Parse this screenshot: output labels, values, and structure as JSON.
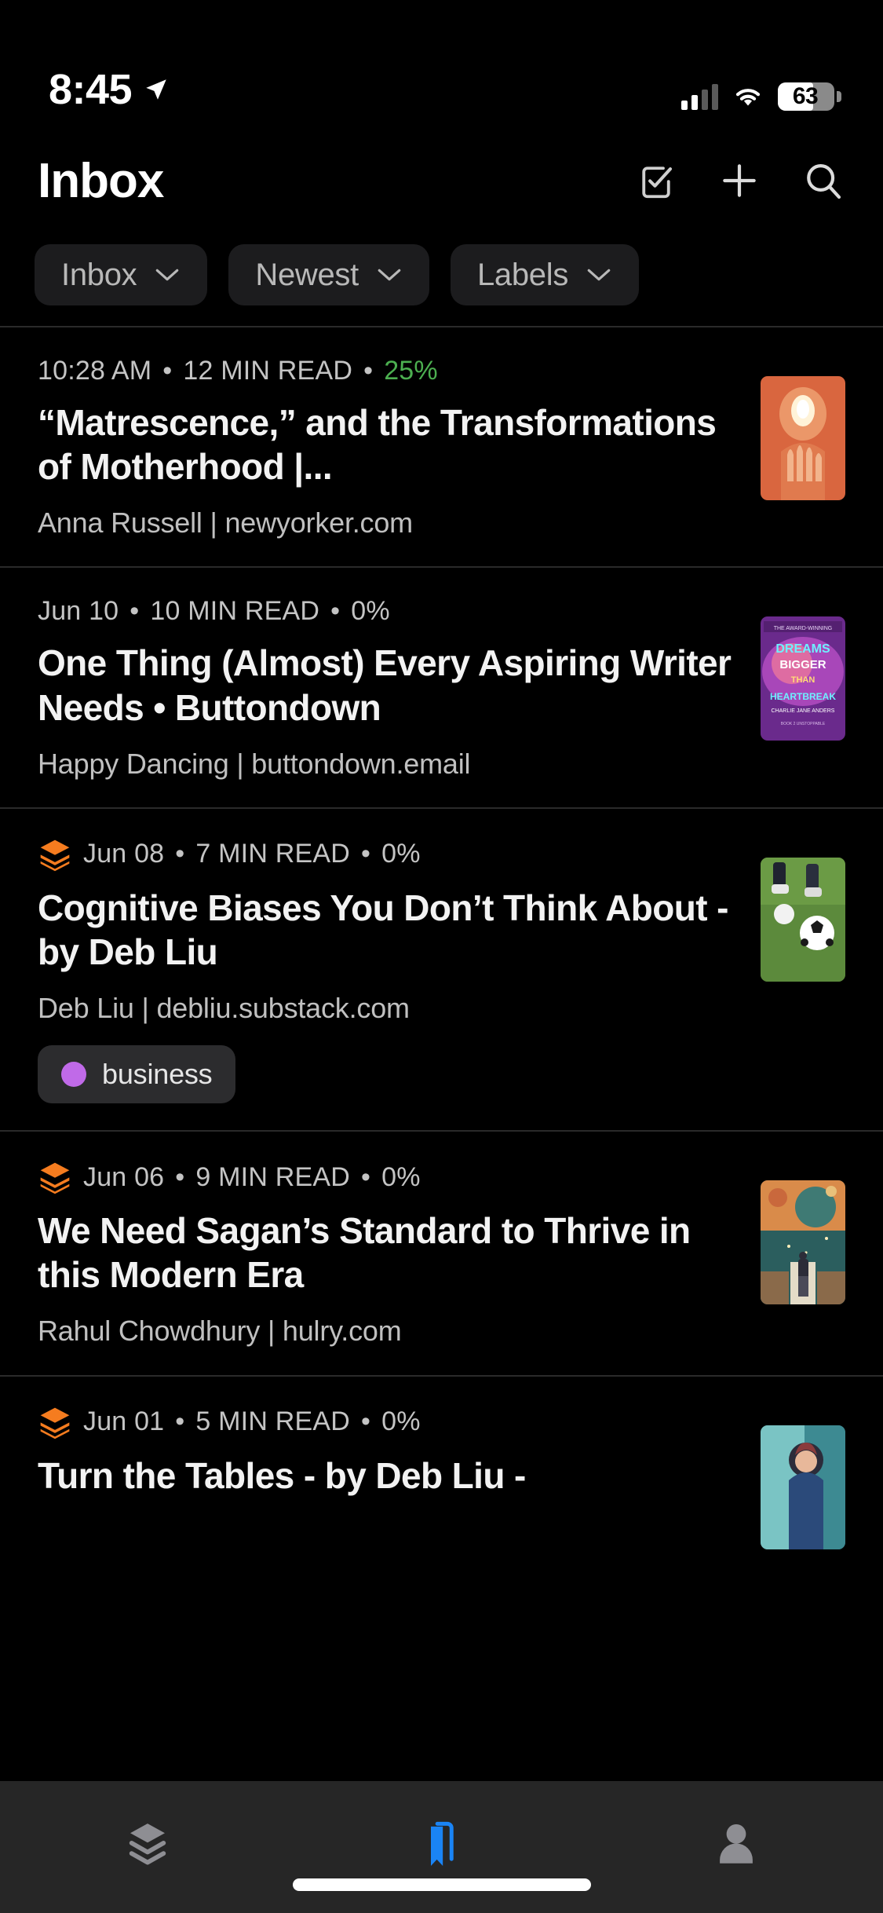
{
  "status_bar": {
    "time": "8:45",
    "location_icon": "location-arrow-icon",
    "cellular_icon": "cellular-signal-icon",
    "wifi_icon": "wifi-icon",
    "battery_percent": "63",
    "battery_level": 63
  },
  "header": {
    "title": "Inbox",
    "actions": [
      {
        "name": "select-checkbox-icon",
        "label": "Select"
      },
      {
        "name": "add-icon",
        "label": "Add"
      },
      {
        "name": "search-icon",
        "label": "Search"
      }
    ]
  },
  "filters": [
    {
      "label": "Inbox",
      "icon": "chevron-down-icon"
    },
    {
      "label": "Newest",
      "icon": "chevron-down-icon"
    },
    {
      "label": "Labels",
      "icon": "chevron-down-icon"
    }
  ],
  "colors": {
    "background": "#000000",
    "chip_background": "#1c1c1e",
    "progress_green": "#4caf50",
    "source_orange": "#f57c1f",
    "label_purple": "#c06ae8",
    "active_tab_blue": "#1a84f5",
    "inactive_tab_gray": "#8e8e93",
    "tabbar_background": "#262626"
  },
  "articles": [
    {
      "source_icon": null,
      "date": "10:28 AM",
      "read_time": "12 MIN READ",
      "progress": "25%",
      "progress_is_green": true,
      "title": "“Matrescence,” and the Transformations of Motherhood |...",
      "byline": "Anna Russell | newyorker.com",
      "label": null,
      "thumbnail": "orange-hands-light"
    },
    {
      "source_icon": null,
      "date": "Jun 10",
      "read_time": "10 MIN READ",
      "progress": "0%",
      "progress_is_green": false,
      "title": "One Thing (Almost) Every Aspiring Writer Needs • Buttondown",
      "byline": "Happy Dancing | buttondown.email",
      "label": null,
      "thumbnail": "book-cover-dreams"
    },
    {
      "source_icon": "stack-icon",
      "date": "Jun 08",
      "read_time": "7 MIN READ",
      "progress": "0%",
      "progress_is_green": false,
      "title": "Cognitive Biases You Don’t Think About - by Deb Liu",
      "byline": "Deb Liu | debliu.substack.com",
      "label": "business",
      "thumbnail": "soccer-ball-grass"
    },
    {
      "source_icon": "stack-icon",
      "date": "Jun 06",
      "read_time": "9 MIN READ",
      "progress": "0%",
      "progress_is_green": false,
      "title": "We Need Sagan’s Standard to Thrive in this Modern Era",
      "byline": "Rahul Chowdhury | hulry.com",
      "label": null,
      "thumbnail": "space-planet-person"
    },
    {
      "source_icon": "stack-icon",
      "date": "Jun 01",
      "read_time": "5 MIN READ",
      "progress": "0%",
      "progress_is_green": false,
      "title": "Turn the Tables - by Deb Liu -",
      "byline": "",
      "label": null,
      "thumbnail": "woman-illustration"
    }
  ],
  "tabs": [
    {
      "name": "tab-library",
      "icon": "layers-stack-icon",
      "active": false
    },
    {
      "name": "tab-bookmarks",
      "icon": "bookmark-icon",
      "active": true
    },
    {
      "name": "tab-profile",
      "icon": "person-icon",
      "active": false
    }
  ]
}
